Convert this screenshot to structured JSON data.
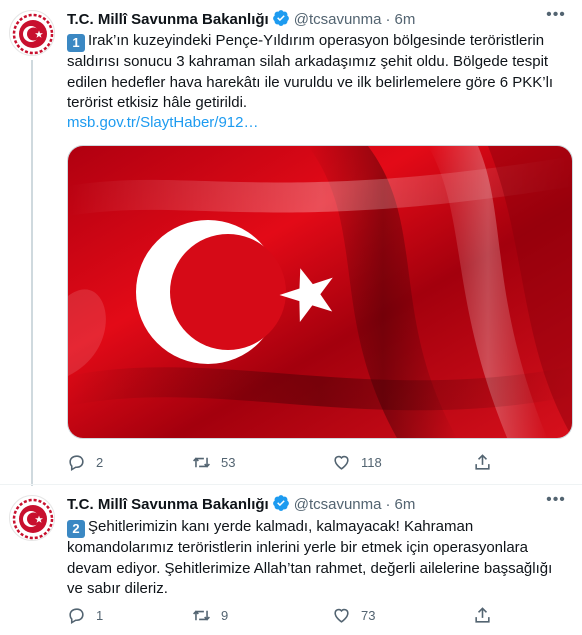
{
  "tweets": [
    {
      "author_name": "T.C. Millî Savunma Bakanlığı",
      "handle": "@tcsavunma",
      "time": "6m",
      "number_badge": "1",
      "text": "Irak’ın kuzeyindeki Pençe-Yıldırım operasyon bölgesinde teröristlerin saldırısı sonucu 3 kahraman silah arkadaşımız şehit oldu. Bölgede tespit edilen hedefler hava harekâtı ile vuruldu ve ilk belirlemelere göre 6 PKK’lı terörist etkisiz hâle getirildi.",
      "link": "msb.gov.tr/SlaytHaber/912…",
      "media": "turkish-flag-image",
      "replies": "2",
      "retweets": "53",
      "likes": "118"
    },
    {
      "author_name": "T.C. Millî Savunma Bakanlığı",
      "handle": "@tcsavunma",
      "time": "6m",
      "number_badge": "2",
      "text": "Şehitlerimizin kanı yerde kalmadı, kalmayacak! Kahraman komandolarımız teröristlerin inlerini yerle bir etmek için operasyonlara devam ediyor. Şehitlerimize Allah’tan rahmet, değerli ailelerine başsağlığı ve sabır dileriz.",
      "replies": "1",
      "retweets": "9",
      "likes": "73"
    }
  ],
  "colors": {
    "link": "#1d9bf0",
    "verified": "#1d9bf0",
    "muted": "#536471",
    "flag_red": "#e30a17",
    "keycap": "#3b88c3"
  },
  "icons": [
    "verified-badge-icon",
    "more-icon",
    "reply-icon",
    "retweet-icon",
    "like-icon",
    "share-icon",
    "msb-logo-icon"
  ]
}
